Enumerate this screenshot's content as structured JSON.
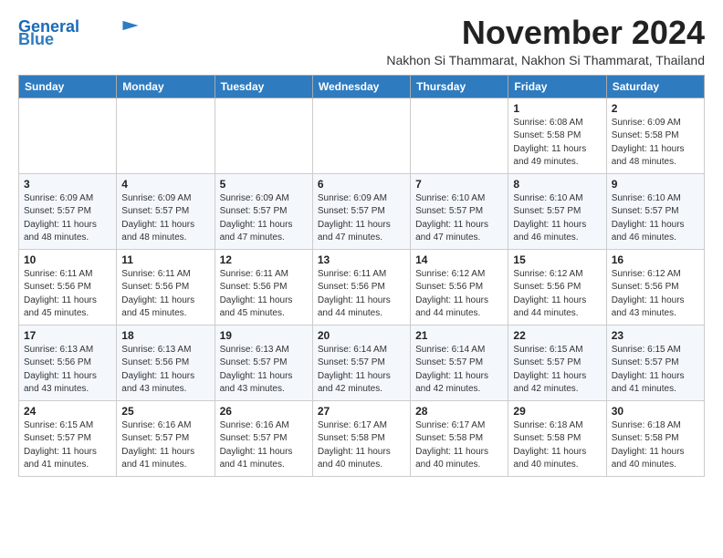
{
  "logo": {
    "line1": "General",
    "line2": "Blue"
  },
  "header": {
    "month_title": "November 2024",
    "subtitle": "Nakhon Si Thammarat, Nakhon Si Thammarat, Thailand"
  },
  "days_of_week": [
    "Sunday",
    "Monday",
    "Tuesday",
    "Wednesday",
    "Thursday",
    "Friday",
    "Saturday"
  ],
  "weeks": [
    [
      {
        "day": "",
        "info": ""
      },
      {
        "day": "",
        "info": ""
      },
      {
        "day": "",
        "info": ""
      },
      {
        "day": "",
        "info": ""
      },
      {
        "day": "",
        "info": ""
      },
      {
        "day": "1",
        "info": "Sunrise: 6:08 AM\nSunset: 5:58 PM\nDaylight: 11 hours\nand 49 minutes."
      },
      {
        "day": "2",
        "info": "Sunrise: 6:09 AM\nSunset: 5:58 PM\nDaylight: 11 hours\nand 48 minutes."
      }
    ],
    [
      {
        "day": "3",
        "info": "Sunrise: 6:09 AM\nSunset: 5:57 PM\nDaylight: 11 hours\nand 48 minutes."
      },
      {
        "day": "4",
        "info": "Sunrise: 6:09 AM\nSunset: 5:57 PM\nDaylight: 11 hours\nand 48 minutes."
      },
      {
        "day": "5",
        "info": "Sunrise: 6:09 AM\nSunset: 5:57 PM\nDaylight: 11 hours\nand 47 minutes."
      },
      {
        "day": "6",
        "info": "Sunrise: 6:09 AM\nSunset: 5:57 PM\nDaylight: 11 hours\nand 47 minutes."
      },
      {
        "day": "7",
        "info": "Sunrise: 6:10 AM\nSunset: 5:57 PM\nDaylight: 11 hours\nand 47 minutes."
      },
      {
        "day": "8",
        "info": "Sunrise: 6:10 AM\nSunset: 5:57 PM\nDaylight: 11 hours\nand 46 minutes."
      },
      {
        "day": "9",
        "info": "Sunrise: 6:10 AM\nSunset: 5:57 PM\nDaylight: 11 hours\nand 46 minutes."
      }
    ],
    [
      {
        "day": "10",
        "info": "Sunrise: 6:11 AM\nSunset: 5:56 PM\nDaylight: 11 hours\nand 45 minutes."
      },
      {
        "day": "11",
        "info": "Sunrise: 6:11 AM\nSunset: 5:56 PM\nDaylight: 11 hours\nand 45 minutes."
      },
      {
        "day": "12",
        "info": "Sunrise: 6:11 AM\nSunset: 5:56 PM\nDaylight: 11 hours\nand 45 minutes."
      },
      {
        "day": "13",
        "info": "Sunrise: 6:11 AM\nSunset: 5:56 PM\nDaylight: 11 hours\nand 44 minutes."
      },
      {
        "day": "14",
        "info": "Sunrise: 6:12 AM\nSunset: 5:56 PM\nDaylight: 11 hours\nand 44 minutes."
      },
      {
        "day": "15",
        "info": "Sunrise: 6:12 AM\nSunset: 5:56 PM\nDaylight: 11 hours\nand 44 minutes."
      },
      {
        "day": "16",
        "info": "Sunrise: 6:12 AM\nSunset: 5:56 PM\nDaylight: 11 hours\nand 43 minutes."
      }
    ],
    [
      {
        "day": "17",
        "info": "Sunrise: 6:13 AM\nSunset: 5:56 PM\nDaylight: 11 hours\nand 43 minutes."
      },
      {
        "day": "18",
        "info": "Sunrise: 6:13 AM\nSunset: 5:56 PM\nDaylight: 11 hours\nand 43 minutes."
      },
      {
        "day": "19",
        "info": "Sunrise: 6:13 AM\nSunset: 5:57 PM\nDaylight: 11 hours\nand 43 minutes."
      },
      {
        "day": "20",
        "info": "Sunrise: 6:14 AM\nSunset: 5:57 PM\nDaylight: 11 hours\nand 42 minutes."
      },
      {
        "day": "21",
        "info": "Sunrise: 6:14 AM\nSunset: 5:57 PM\nDaylight: 11 hours\nand 42 minutes."
      },
      {
        "day": "22",
        "info": "Sunrise: 6:15 AM\nSunset: 5:57 PM\nDaylight: 11 hours\nand 42 minutes."
      },
      {
        "day": "23",
        "info": "Sunrise: 6:15 AM\nSunset: 5:57 PM\nDaylight: 11 hours\nand 41 minutes."
      }
    ],
    [
      {
        "day": "24",
        "info": "Sunrise: 6:15 AM\nSunset: 5:57 PM\nDaylight: 11 hours\nand 41 minutes."
      },
      {
        "day": "25",
        "info": "Sunrise: 6:16 AM\nSunset: 5:57 PM\nDaylight: 11 hours\nand 41 minutes."
      },
      {
        "day": "26",
        "info": "Sunrise: 6:16 AM\nSunset: 5:57 PM\nDaylight: 11 hours\nand 41 minutes."
      },
      {
        "day": "27",
        "info": "Sunrise: 6:17 AM\nSunset: 5:58 PM\nDaylight: 11 hours\nand 40 minutes."
      },
      {
        "day": "28",
        "info": "Sunrise: 6:17 AM\nSunset: 5:58 PM\nDaylight: 11 hours\nand 40 minutes."
      },
      {
        "day": "29",
        "info": "Sunrise: 6:18 AM\nSunset: 5:58 PM\nDaylight: 11 hours\nand 40 minutes."
      },
      {
        "day": "30",
        "info": "Sunrise: 6:18 AM\nSunset: 5:58 PM\nDaylight: 11 hours\nand 40 minutes."
      }
    ]
  ]
}
